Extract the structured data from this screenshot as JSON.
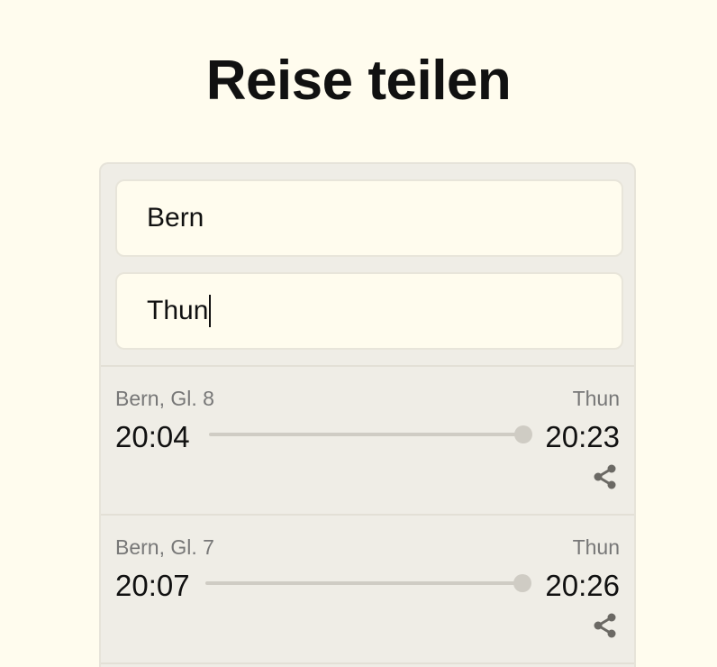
{
  "title": "Reise teilen",
  "search": {
    "from_value": "Bern",
    "to_value": "Thun"
  },
  "connections": [
    {
      "from_label": "Bern, Gl. 8",
      "to_label": "Thun",
      "departure": "20:04",
      "arrival": "20:23"
    },
    {
      "from_label": "Bern, Gl. 7",
      "to_label": "Thun",
      "departure": "20:07",
      "arrival": "20:26"
    }
  ],
  "colors": {
    "background": "#fffcee",
    "card": "#efede6",
    "muted_text": "#777777",
    "track": "#cfccc4",
    "share_icon": "#6b6964"
  }
}
